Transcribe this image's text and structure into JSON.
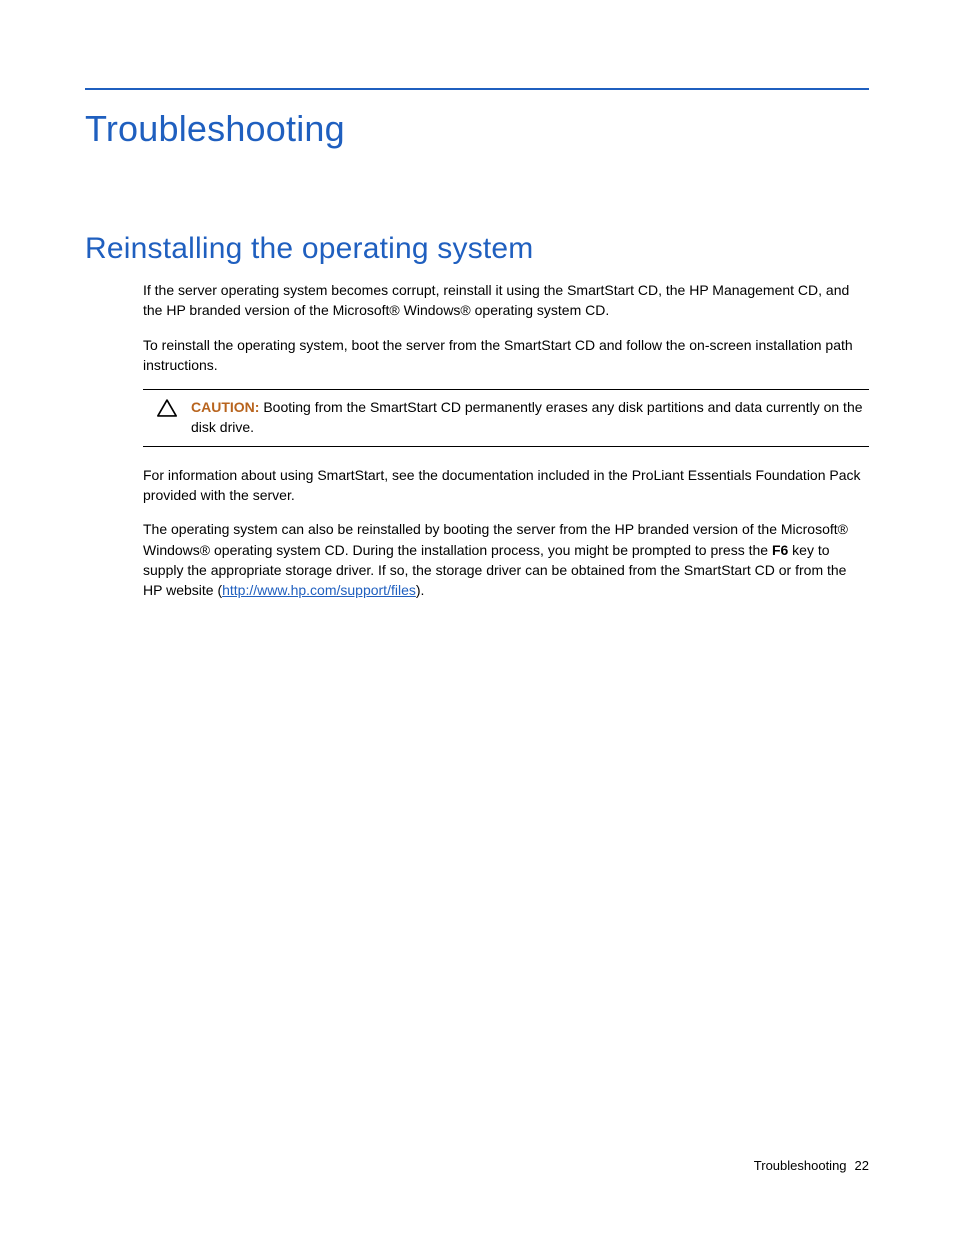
{
  "h1": "Troubleshooting",
  "h2": "Reinstalling the operating system",
  "para1": "If the server operating system becomes corrupt, reinstall it using the SmartStart CD, the HP Management CD, and the HP branded version of the Microsoft® Windows® operating system CD.",
  "para2": "To reinstall the operating system, boot the server from the SmartStart CD and follow the on-screen installation path instructions.",
  "caution_label": "CAUTION:",
  "caution_text": "  Booting from the SmartStart CD permanently erases any disk partitions and data currently on the disk drive.",
  "para3": "For information about using SmartStart, see the documentation included in the ProLiant Essentials Foundation Pack provided with the server.",
  "para4_a": "The operating system can also be reinstalled by booting the server from the HP branded version of the Microsoft® Windows® operating system CD. During the installation process, you might be prompted to press the ",
  "para4_key": "F6",
  "para4_b": " key to supply the appropriate storage driver. If so, the storage driver can be obtained from the SmartStart CD or from the HP website (",
  "para4_link": "http://www.hp.com/support/files",
  "para4_c": ").",
  "footer_label": "Troubleshooting",
  "footer_page": "22"
}
